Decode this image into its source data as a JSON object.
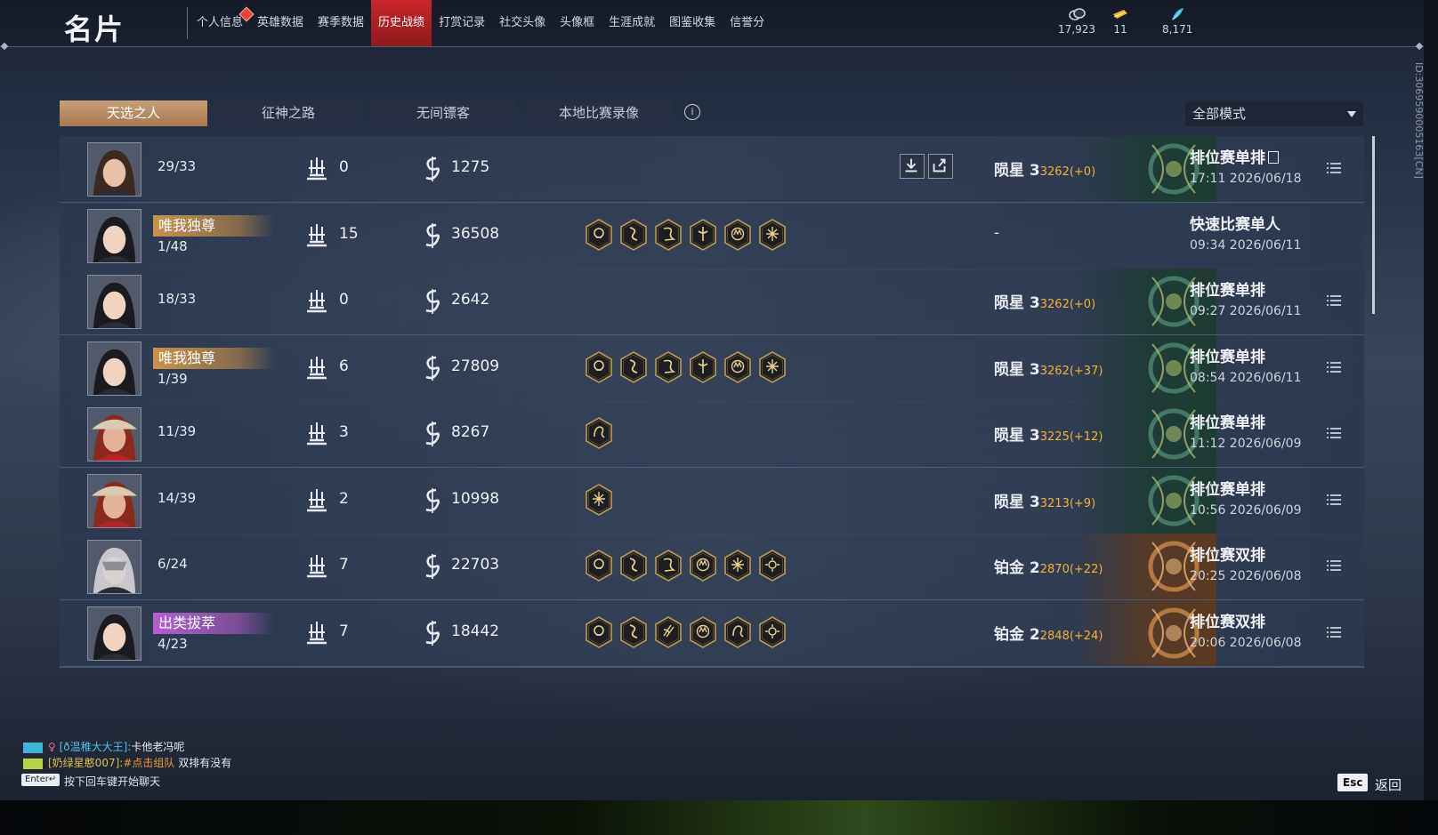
{
  "header": {
    "title": "名片",
    "nav_tabs": [
      {
        "label": "个人信息",
        "active": false,
        "badge": true
      },
      {
        "label": "英雄数据",
        "active": false
      },
      {
        "label": "赛季数据",
        "active": false
      },
      {
        "label": "历史战绩",
        "active": true
      },
      {
        "label": "打赏记录",
        "active": false
      },
      {
        "label": "社交头像",
        "active": false
      },
      {
        "label": "头像框",
        "active": false
      },
      {
        "label": "生涯成就",
        "active": false
      },
      {
        "label": "图鉴收集",
        "active": false
      },
      {
        "label": "信誉分",
        "active": false
      }
    ],
    "currencies": [
      {
        "icon": "coin-icon",
        "value": "17,923"
      },
      {
        "icon": "ticket-icon",
        "value": "11"
      },
      {
        "icon": "feather-icon",
        "value": "8,171"
      }
    ]
  },
  "sub_tabs": [
    {
      "label": "天选之人",
      "active": true
    },
    {
      "label": "征神之路",
      "active": false
    },
    {
      "label": "无间镖客",
      "active": false
    },
    {
      "label": "本地比赛录像",
      "active": false
    }
  ],
  "info_icon": "i",
  "mode_filter": {
    "selected": "全部模式"
  },
  "matches": [
    {
      "avatar": "hero-a",
      "title": "",
      "title_color": "",
      "rank": "29/33",
      "kills": "0",
      "damage": "1275",
      "badges": [],
      "actions": true,
      "tier": "陨星 3",
      "points": "3262(+0)",
      "tier_art": "green",
      "mode": "排位赛单排",
      "mode_icon": true,
      "time": "17:11  2026/06/18",
      "menu": true
    },
    {
      "avatar": "hero-b",
      "title": "唯我独尊",
      "title_color": "gold",
      "rank": "1/48",
      "kills": "15",
      "damage": "36508",
      "badges": [
        "skull",
        "serpent",
        "dragon",
        "sword",
        "crown",
        "star"
      ],
      "actions": false,
      "tier": "",
      "points": "",
      "tier_art": "",
      "dash": "-",
      "mode": "快速比赛单人",
      "mode_icon": false,
      "time": "09:34  2026/06/11",
      "menu": false
    },
    {
      "avatar": "hero-b",
      "title": "",
      "title_color": "",
      "rank": "18/33",
      "kills": "0",
      "damage": "2642",
      "badges": [],
      "actions": false,
      "tier": "陨星 3",
      "points": "3262(+0)",
      "tier_art": "green",
      "mode": "排位赛单排",
      "mode_icon": false,
      "time": "09:27  2026/06/11",
      "menu": true
    },
    {
      "avatar": "hero-b",
      "title": "唯我独尊",
      "title_color": "gold",
      "rank": "1/39",
      "kills": "6",
      "damage": "27809",
      "badges": [
        "skull",
        "serpent",
        "dragon",
        "sword",
        "crown",
        "star"
      ],
      "actions": false,
      "tier": "陨星 3",
      "points": "3262(+37)",
      "tier_art": "green",
      "mode": "排位赛单排",
      "mode_icon": false,
      "time": "08:54  2026/06/11",
      "menu": true
    },
    {
      "avatar": "hero-c",
      "title": "",
      "title_color": "",
      "rank": "11/39",
      "kills": "3",
      "damage": "8267",
      "badges": [
        "beast"
      ],
      "actions": false,
      "tier": "陨星 3",
      "points": "3225(+12)",
      "tier_art": "green",
      "mode": "排位赛单排",
      "mode_icon": false,
      "time": "11:12  2026/06/09",
      "menu": true
    },
    {
      "avatar": "hero-c",
      "title": "",
      "title_color": "",
      "rank": "14/39",
      "kills": "2",
      "damage": "10998",
      "badges": [
        "star"
      ],
      "actions": false,
      "tier": "陨星 3",
      "points": "3213(+9)",
      "tier_art": "green",
      "mode": "排位赛单排",
      "mode_icon": false,
      "time": "10:56  2026/06/09",
      "menu": true
    },
    {
      "avatar": "hero-d",
      "title": "",
      "title_color": "",
      "rank": "6/24",
      "kills": "7",
      "damage": "22703",
      "badges": [
        "skull",
        "serpent",
        "dragon",
        "crown",
        "star",
        "sun"
      ],
      "actions": false,
      "tier": "铂金 2",
      "points": "2870(+22)",
      "tier_art": "bronze",
      "mode": "排位赛双排",
      "mode_icon": false,
      "time": "20:25  2026/06/08",
      "menu": true
    },
    {
      "avatar": "hero-b",
      "title": "出类拔萃",
      "title_color": "purple",
      "rank": "4/23",
      "kills": "7",
      "damage": "18442",
      "badges": [
        "skull",
        "serpent",
        "claw",
        "crown",
        "beast",
        "sun"
      ],
      "actions": false,
      "tier": "铂金 2",
      "points": "2848(+24)",
      "tier_art": "bronze",
      "mode": "排位赛双排",
      "mode_icon": false,
      "time": "20:06  2026/06/08",
      "menu": true
    }
  ],
  "chat": {
    "lines": [
      {
        "channel_color": "#3fb6d9",
        "gender": "♀",
        "name": "[ð温稚大大王]:",
        "message": "卡他老冯呢",
        "name_color": "cyan"
      },
      {
        "channel_color": "#b7d34a",
        "gender": "",
        "name": "[奶绿星憨007]:",
        "link": "#点击组队",
        "message": " 双排有没有",
        "name_color": "yellow"
      }
    ],
    "enter_key": "Enter↵",
    "hint": "按下回车键开始聊天"
  },
  "footer": {
    "esc_key": "Esc",
    "back_label": "返回"
  },
  "player_id": "ID:3069590005163[CN]",
  "colors": {
    "accent_red": "#c8262a",
    "gold_tab": "#c7a176",
    "points_orange": "#f0b23a"
  }
}
